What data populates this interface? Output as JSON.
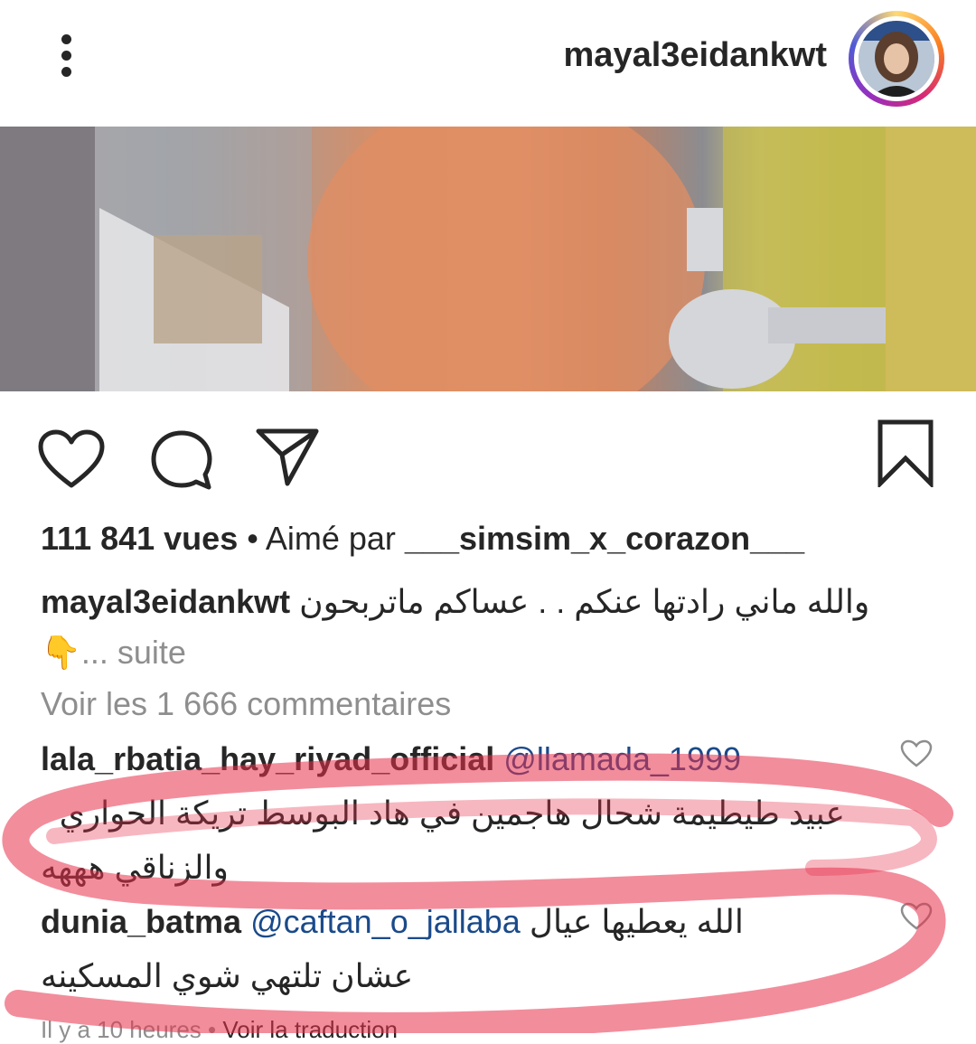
{
  "header": {
    "username": "mayal3eidankwt",
    "more_icon": "more-vertical-icon"
  },
  "actions": {
    "like_icon": "heart-icon",
    "comment_icon": "comment-icon",
    "share_icon": "paper-plane-icon",
    "save_icon": "bookmark-icon"
  },
  "stats": {
    "views": "111 841 vues",
    "separator": " • Aimé par ",
    "liked_by": "___simsim_x_corazon___"
  },
  "caption": {
    "username": "mayal3eidankwt",
    "text": "والله ماني رادتها عنكم . . عساكم ماتربحون",
    "emoji": "👇",
    "more": "... suite"
  },
  "view_all_comments": "Voir les 1 666 commentaires",
  "comments": [
    {
      "username": "lala_rbatia_hay_riyad_official",
      "mention": "@llamada_1999",
      "line1": "عبيد طيطيمة شحال هاجمين في هاد البوسط تريكة الحواري",
      "line2": "والزناقي هههه"
    },
    {
      "username": "dunia_batma",
      "mention": "@caftan_o_jallaba",
      "line1": "الله يعطيها عيال",
      "line2": "عشان تلتهي  شوي المسكينه"
    }
  ],
  "footer": {
    "time": "Il y a 10 heures",
    "separator": " • ",
    "translate": "Voir la traduction"
  },
  "colors": {
    "text": "#262626",
    "secondary": "#8e8e8e",
    "mention": "#1a4a8a",
    "highlight": "#e8304a"
  }
}
